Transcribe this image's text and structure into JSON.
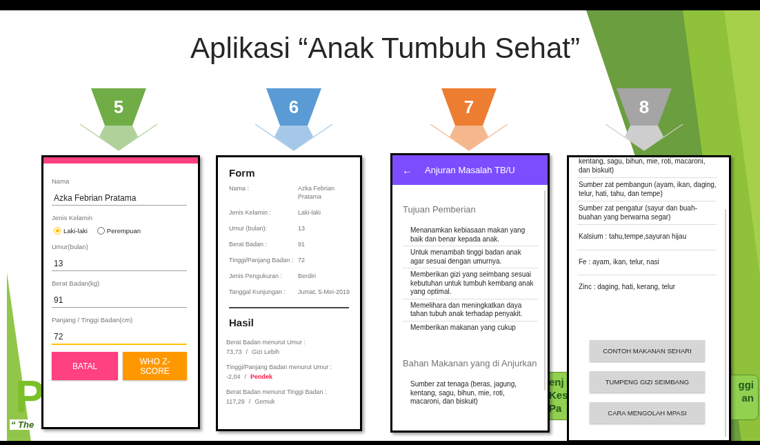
{
  "slide": {
    "title": "Aplikasi “Anak Tumbuh Sehat”"
  },
  "steps": [
    {
      "number": "5",
      "color": "#70ad47"
    },
    {
      "number": "6",
      "color": "#5b9bd5"
    },
    {
      "number": "7",
      "color": "#ed7d31"
    },
    {
      "number": "8",
      "color": "#a5a5a5"
    }
  ],
  "background_fragments": {
    "logo_letter": "P",
    "tagline": "“ The",
    "left_callout": [
      "enj",
      "Kes",
      "Pa"
    ],
    "right_callout": [
      "ggi",
      "an"
    ]
  },
  "screen_form": {
    "fields": [
      {
        "label": "Nama",
        "value": "Azka Febrian Pratama",
        "focused": false
      },
      {
        "label": "Jenis Kelamin",
        "options": [
          {
            "label": "Laki-laki",
            "selected": true
          },
          {
            "label": "Perempuan",
            "selected": false
          }
        ]
      },
      {
        "label": "Umur(bulan)",
        "value": "13",
        "focused": false
      },
      {
        "label": "Berat Badan(kg)",
        "value": "91",
        "focused": false
      },
      {
        "label": "Panjang / Tinggi Badan(cm)",
        "value": "72",
        "focused": true
      }
    ],
    "buttons": [
      {
        "label": "BATAL",
        "kind": "cancel"
      },
      {
        "label": "WHO Z-SCORE",
        "kind": "primary"
      }
    ]
  },
  "screen_result": {
    "form_title": "Form",
    "rows": [
      {
        "label": "Nama :",
        "value": "Azka Febrian Pratama"
      },
      {
        "label": "Jenis Kelamin :",
        "value": "Laki-laki"
      },
      {
        "label": "Umur (bulan):",
        "value": "13"
      },
      {
        "label": "Berat Badan :",
        "value": "91"
      },
      {
        "label": "Tinggi/Panjang Badan :",
        "value": "72"
      },
      {
        "label": "Jenis Pengukuran :",
        "value": "Berdiri"
      },
      {
        "label": "Tanggal Kunjungan :",
        "value": "Jumat, 5-Mei-2019"
      }
    ],
    "result_title": "Hasil",
    "results": [
      {
        "label": "Berat Badan menurut Umur :",
        "score": "73,73",
        "separator": "/",
        "status": "Gizi Lebih",
        "alert": false
      },
      {
        "label": "Tinggi/Panjang Badan menurut Umur :",
        "score": "-2,04",
        "separator": "/",
        "status": "Pendek",
        "alert": true
      },
      {
        "label": "Berat Badan menurut Tinggi Badan :",
        "score": "117,29",
        "separator": "/",
        "status": "Gemuk",
        "alert": false
      }
    ]
  },
  "screen_advice": {
    "app_bar": {
      "back": "←",
      "title": "Anjuran Masalah TB/U"
    },
    "sections": [
      {
        "title": "Tujuan Pemberian",
        "items": [
          "Menanamkan kebiasaan makan yang baik dan benar kepada anak.",
          "Untuk menambah tinggi badan anak agar sesuai dengan umurnya.",
          "Memberikan gizi yang seimbang sesuai kebutuhan untuk tumbuh kembang anak yang optimal.",
          "Memelihara dan meningkatkan daya tahan tubuh anak terhadap penyakit.",
          "Memberikan makanan yang cukup"
        ]
      },
      {
        "title": "Bahan Makanan yang di Anjurkan",
        "items": [
          "Sumber zat tenaga (beras, jagung, kentang, sagu, bihun, mie, roti, macaroni, dan biskuit)"
        ]
      }
    ]
  },
  "screen_foods": {
    "items": [
      "kentang, sagu, bihun, mie, roti, macaroni, dan biskuit)",
      "Sumber zat pembangun (ayam, ikan, daging, telur, hati, tahu, dan tempe)",
      "Sumber zat pengatur (sayur dan buah-buahan yang berwarna segar)",
      "Kalsium : tahu,tempe,sayuran hijau",
      "Fe : ayam, ikan, telur, nasi",
      "Zinc : daging, hati, kerang, telur"
    ],
    "buttons": [
      "CONTOH MAKANAN SEHARI",
      "TUMPENG GIZI SEIMBANG",
      "CARA MENGOLAH MPASI"
    ]
  }
}
